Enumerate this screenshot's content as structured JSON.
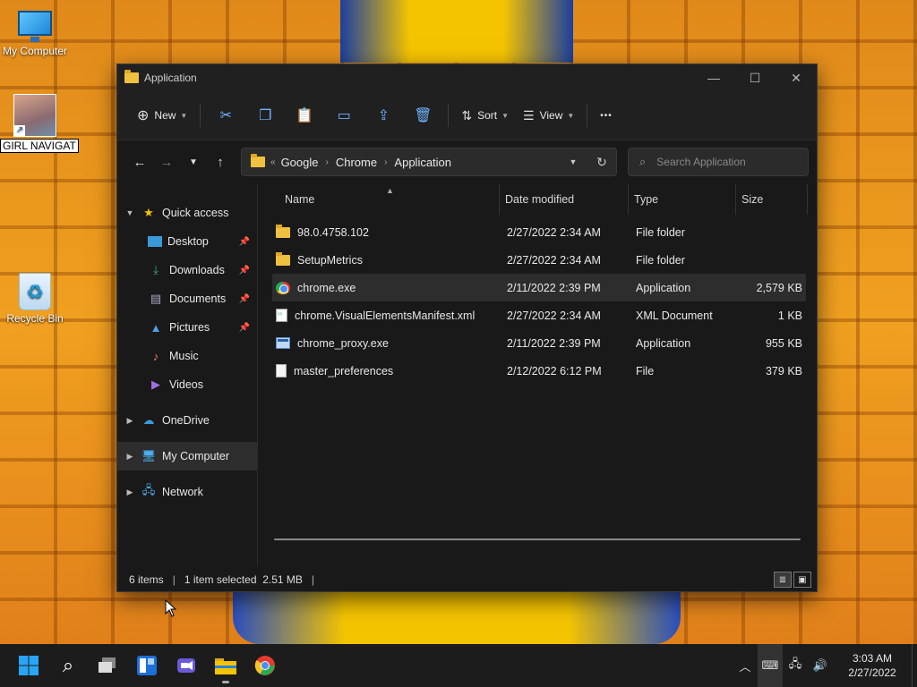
{
  "desktop": {
    "icons": [
      {
        "label": "My Computer"
      },
      {
        "label": "GIRL NAVIGAT"
      },
      {
        "label": "Recycle Bin"
      }
    ]
  },
  "window": {
    "title": "Application",
    "controls": {
      "minimize": "—",
      "maximize": "☐",
      "close": "✕"
    }
  },
  "toolbar": {
    "new_label": "New",
    "sort_label": "Sort",
    "view_label": "View",
    "more": "•••"
  },
  "address": {
    "overflow": "«",
    "crumbs": [
      "Google",
      "Chrome",
      "Application"
    ]
  },
  "search": {
    "placeholder": "Search Application"
  },
  "sidebar": {
    "items": [
      {
        "label": "Quick access"
      },
      {
        "label": "Desktop"
      },
      {
        "label": "Downloads"
      },
      {
        "label": "Documents"
      },
      {
        "label": "Pictures"
      },
      {
        "label": "Music"
      },
      {
        "label": "Videos"
      },
      {
        "label": "OneDrive"
      },
      {
        "label": "My Computer"
      },
      {
        "label": "Network"
      }
    ]
  },
  "columns": {
    "name": "Name",
    "date": "Date modified",
    "type": "Type",
    "size": "Size"
  },
  "files": [
    {
      "name": "98.0.4758.102",
      "date": "2/27/2022 2:34 AM",
      "type": "File folder",
      "size": "",
      "icon": "folder-icon"
    },
    {
      "name": "SetupMetrics",
      "date": "2/27/2022 2:34 AM",
      "type": "File folder",
      "size": "",
      "icon": "folder-icon"
    },
    {
      "name": "chrome.exe",
      "date": "2/11/2022 2:39 PM",
      "type": "Application",
      "size": "2,579 KB",
      "icon": "chrome-icon"
    },
    {
      "name": "chrome.VisualElementsManifest.xml",
      "date": "2/27/2022 2:34 AM",
      "type": "XML Document",
      "size": "1 KB",
      "icon": "xml-file-icon"
    },
    {
      "name": "chrome_proxy.exe",
      "date": "2/11/2022 2:39 PM",
      "type": "Application",
      "size": "955 KB",
      "icon": "exe-icon"
    },
    {
      "name": "master_preferences",
      "date": "2/12/2022 6:12 PM",
      "type": "File",
      "size": "379 KB",
      "icon": "file-icon"
    }
  ],
  "status": {
    "count": "6 items",
    "selection": "1 item selected  2.51 MB"
  },
  "taskbar": {
    "clock_time": "3:03 AM",
    "clock_date": "2/27/2022"
  },
  "colors": {
    "accent": "#6fb3ff",
    "window_bg": "#191919",
    "selection": "#2d2d2d"
  }
}
